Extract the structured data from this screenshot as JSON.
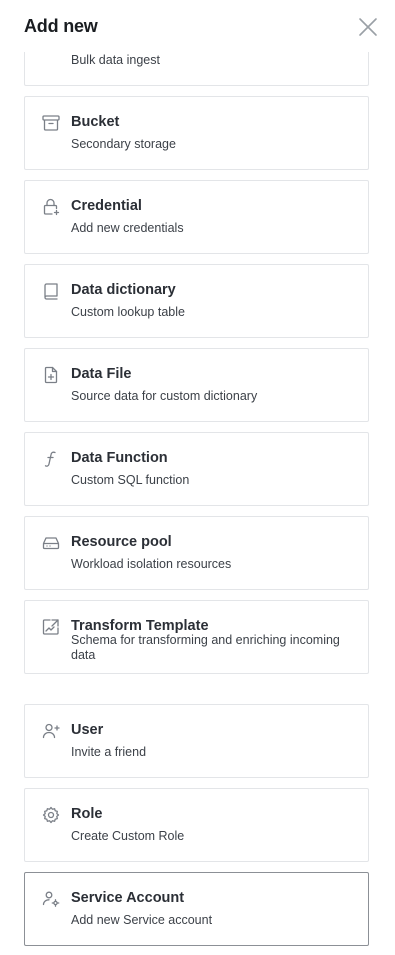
{
  "header": {
    "title": "Add new",
    "close_icon": "close-icon"
  },
  "items": [
    {
      "name": "",
      "desc": "Bulk data ingest",
      "icon": "pipe-icon"
    },
    {
      "name": "Bucket",
      "desc": "Secondary storage",
      "icon": "archive-box-icon"
    },
    {
      "name": "Credential",
      "desc": "Add new credentials",
      "icon": "lock-plus-icon"
    },
    {
      "name": "Data dictionary",
      "desc": "Custom lookup table",
      "icon": "book-icon"
    },
    {
      "name": "Data File",
      "desc": "Source data for custom dictionary",
      "icon": "file-plus-icon"
    },
    {
      "name": "Data Function",
      "desc": "Custom SQL function",
      "icon": "function-icon"
    },
    {
      "name": "Resource pool",
      "desc": "Workload isolation resources",
      "icon": "hard-drive-icon"
    },
    {
      "name": "Transform Template",
      "desc": "Schema for transforming and enriching incoming data",
      "icon": "transform-icon"
    },
    {
      "name": "User",
      "desc": "Invite a friend",
      "icon": "user-plus-icon"
    },
    {
      "name": "Role",
      "desc": "Create Custom Role",
      "icon": "gear-icon"
    },
    {
      "name": "Service Account",
      "desc": "Add new Service account",
      "icon": "user-gear-icon"
    }
  ],
  "colors": {
    "icon": "#7a7f87",
    "border": "#e3e5e8",
    "active_border": "#8c9096"
  }
}
